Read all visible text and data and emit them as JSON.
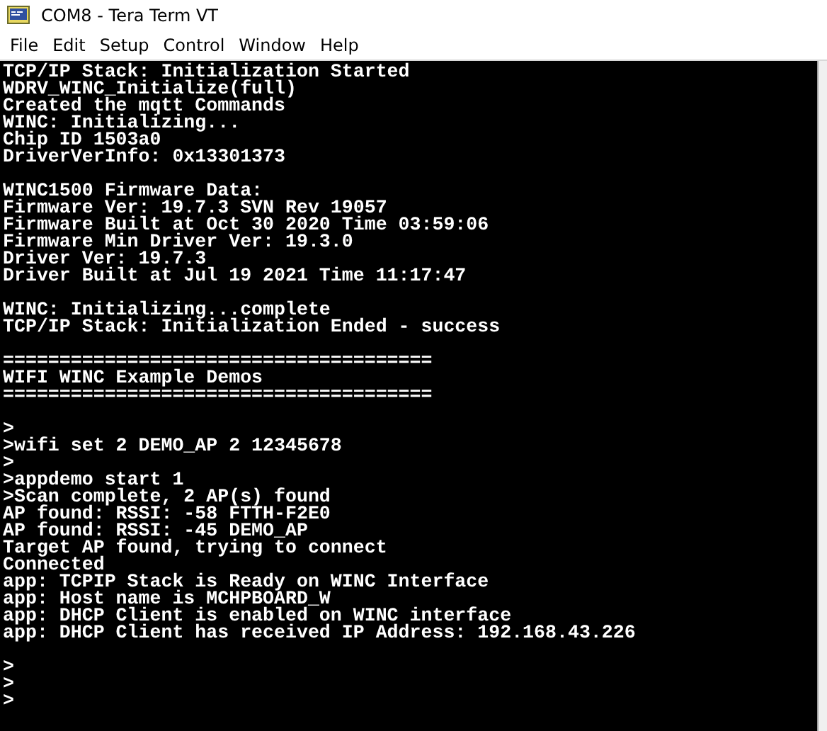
{
  "window": {
    "title": "COM8 - Tera Term VT"
  },
  "menu": [
    "File",
    "Edit",
    "Setup",
    "Control",
    "Window",
    "Help"
  ],
  "terminal": {
    "lines": [
      {
        "kind": "text",
        "text": "TCP/IP Stack: Initialization Started"
      },
      {
        "kind": "text",
        "text": "WDRV_WINC_Initialize(full)"
      },
      {
        "kind": "text",
        "text": "Created the mqtt Commands"
      },
      {
        "kind": "text",
        "text": "WINC: Initializing..."
      },
      {
        "kind": "text",
        "text": "Chip ID 1503a0"
      },
      {
        "kind": "text",
        "text": "DriverVerInfo: 0x13301373"
      },
      {
        "kind": "blank"
      },
      {
        "kind": "text",
        "text": "WINC1500 Firmware Data:"
      },
      {
        "kind": "text",
        "text": "Firmware Ver: 19.7.3 SVN Rev 19057"
      },
      {
        "kind": "text",
        "text": "Firmware Built at Oct 30 2020 Time 03:59:06"
      },
      {
        "kind": "text",
        "text": "Firmware Min Driver Ver: 19.3.0"
      },
      {
        "kind": "text",
        "text": "Driver Ver: 19.7.3"
      },
      {
        "kind": "text",
        "text": "Driver Built at Jul 19 2021 Time 11:17:47"
      },
      {
        "kind": "blank"
      },
      {
        "kind": "text",
        "text": "WINC: Initializing...complete"
      },
      {
        "kind": "text",
        "text": "TCP/IP Stack: Initialization Ended - success"
      },
      {
        "kind": "blank"
      },
      {
        "kind": "text",
        "text": "======================================"
      },
      {
        "kind": "text",
        "text": "WIFI WINC Example Demos"
      },
      {
        "kind": "text",
        "text": "======================================"
      },
      {
        "kind": "blank"
      },
      {
        "kind": "text",
        "text": ">"
      },
      {
        "kind": "text",
        "text": ">wifi set 2 DEMO_AP 2 12345678"
      },
      {
        "kind": "text",
        "text": ">"
      },
      {
        "kind": "text",
        "text": ">appdemo start 1"
      },
      {
        "kind": "text",
        "text": ">Scan complete, 2 AP(s) found"
      },
      {
        "kind": "text",
        "text": "AP found: RSSI: -58 FTTH-F2E0"
      },
      {
        "kind": "text",
        "text": "AP found: RSSI: -45 DEMO_AP"
      },
      {
        "kind": "text",
        "text": "Target AP found, trying to connect"
      },
      {
        "kind": "text",
        "text": "Connected"
      },
      {
        "kind": "text",
        "text": "app: TCPIP Stack is Ready on WINC Interface"
      },
      {
        "kind": "text",
        "text": "app: Host name is MCHPBOARD_W"
      },
      {
        "kind": "text",
        "text": "app: DHCP Client is enabled on WINC interface"
      },
      {
        "kind": "text",
        "text": "app: DHCP Client has received IP Address: 192.168.43.226"
      },
      {
        "kind": "blank"
      },
      {
        "kind": "text",
        "text": ">"
      },
      {
        "kind": "text",
        "text": ">"
      },
      {
        "kind": "text",
        "text": ">"
      }
    ]
  }
}
